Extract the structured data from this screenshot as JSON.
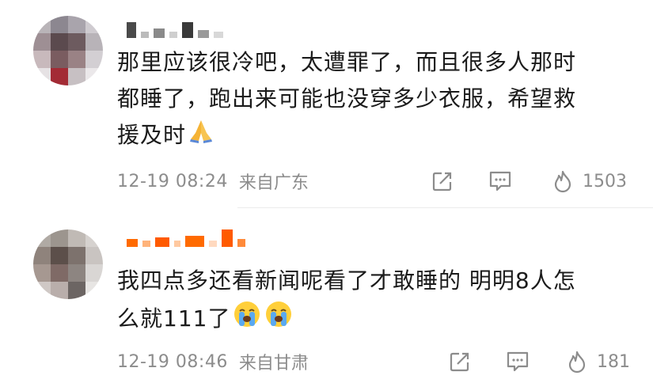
{
  "comments": [
    {
      "text_lines": [
        "那里应该很冷吧，太遭罪了，而且很多人那时",
        "都睡了，跑出来可能也没穿多少衣服，希望救",
        "援及时"
      ],
      "emoji": "folded-hands",
      "time": "12-19 08:24",
      "location": "来自广东",
      "like_count": "1503"
    },
    {
      "text_lines": [
        "我四点多还看新闻呢看了才敢睡的 明明8人怎",
        "么就111了"
      ],
      "emoji": "loudly-crying-face",
      "time": "12-19 08:46",
      "location": "来自甘肃",
      "like_count": "181"
    }
  ],
  "icons": {
    "share": "share-icon",
    "comment": "comment-icon",
    "like": "flame-like-icon"
  },
  "colors": {
    "text": "#1b1b1b",
    "meta": "#8c8c8c",
    "username_pixels_1": "#3a3a3a",
    "username_pixels_2": "#ff6a00"
  }
}
